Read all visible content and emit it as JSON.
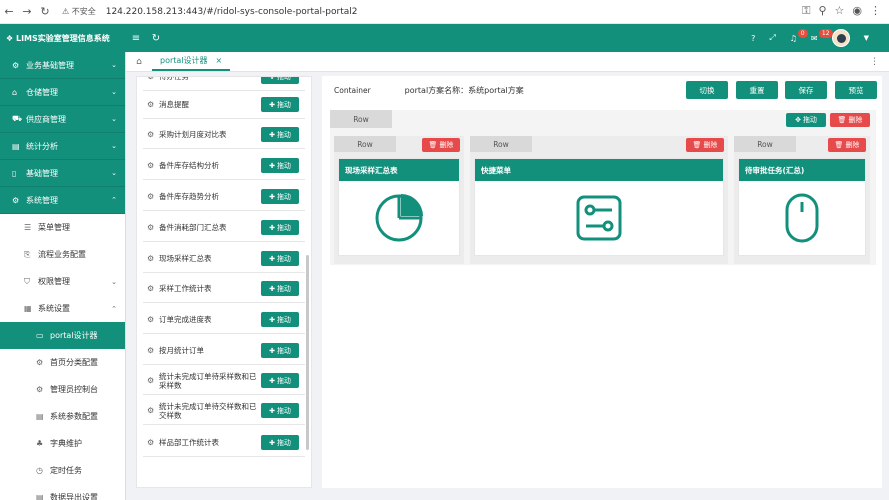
{
  "browser": {
    "insecure": "不安全",
    "url": "124.220.158.213:443/#/ridol-sys-console-portal-portal2"
  },
  "app": {
    "title": "LIMS实验室管理信息系统",
    "badges": {
      "bell": "0",
      "msg": "12"
    }
  },
  "sidebar": {
    "groups": [
      {
        "label": "业务基础管理",
        "icon": "gear-icon"
      },
      {
        "label": "仓储管理",
        "icon": "home-icon"
      },
      {
        "label": "供应商管理",
        "icon": "truck-icon"
      },
      {
        "label": "统计分析",
        "icon": "chart-icon"
      },
      {
        "label": "基础管理",
        "icon": "book-icon"
      },
      {
        "label": "系统管理",
        "icon": "gear-icon"
      }
    ],
    "sys_items": [
      {
        "label": "菜单管理",
        "icon": "list-icon"
      },
      {
        "label": "流程业务配置",
        "icon": "flow-icon"
      },
      {
        "label": "权限管理",
        "icon": "shield-icon"
      },
      {
        "label": "系统设置",
        "icon": "grid-icon"
      }
    ],
    "settings_items": [
      {
        "label": "portal设计器",
        "icon": "monitor-icon"
      },
      {
        "label": "首页分类配置",
        "icon": "gear-icon"
      },
      {
        "label": "管理员控制台",
        "icon": "gear-icon"
      },
      {
        "label": "系统参数配置",
        "icon": "doc-icon"
      },
      {
        "label": "字典维护",
        "icon": "tree-icon"
      },
      {
        "label": "定时任务",
        "icon": "clock-icon"
      },
      {
        "label": "数据导出设置",
        "icon": "doc-icon"
      }
    ]
  },
  "tabs": {
    "active": "portal设计器"
  },
  "library": {
    "drag_label": "拖动",
    "items": [
      "待办任务",
      "消息提醒",
      "采购计划月度对比表",
      "备件库存结构分析",
      "备件库存趋势分析",
      "备件消耗部门汇总表",
      "现场采样汇总表",
      "采样工作统计表",
      "订单完成进度表",
      "按月统计订单",
      "统计未完成订单待采样数和已采样数",
      "统计未完成订单待交样数和已交样数",
      "样品部工作统计表"
    ]
  },
  "designer": {
    "container_label": "Container",
    "scheme_label": "portal方案名称：系统portal方案",
    "buttons": {
      "switch": "切换",
      "reset": "重置",
      "save": "保存",
      "preview": "预览"
    },
    "row_label": "Row",
    "drag_label": "拖动",
    "delete_label": "删除",
    "cards": [
      {
        "title": "现场采样汇总表",
        "icon": "pie-chart-icon"
      },
      {
        "title": "快捷菜单",
        "icon": "switch-panel-icon"
      },
      {
        "title": "待审批任务(汇总)",
        "icon": "mouse-icon"
      }
    ]
  },
  "colors": {
    "brand": "#13907c",
    "danger": "#e64a4a"
  }
}
